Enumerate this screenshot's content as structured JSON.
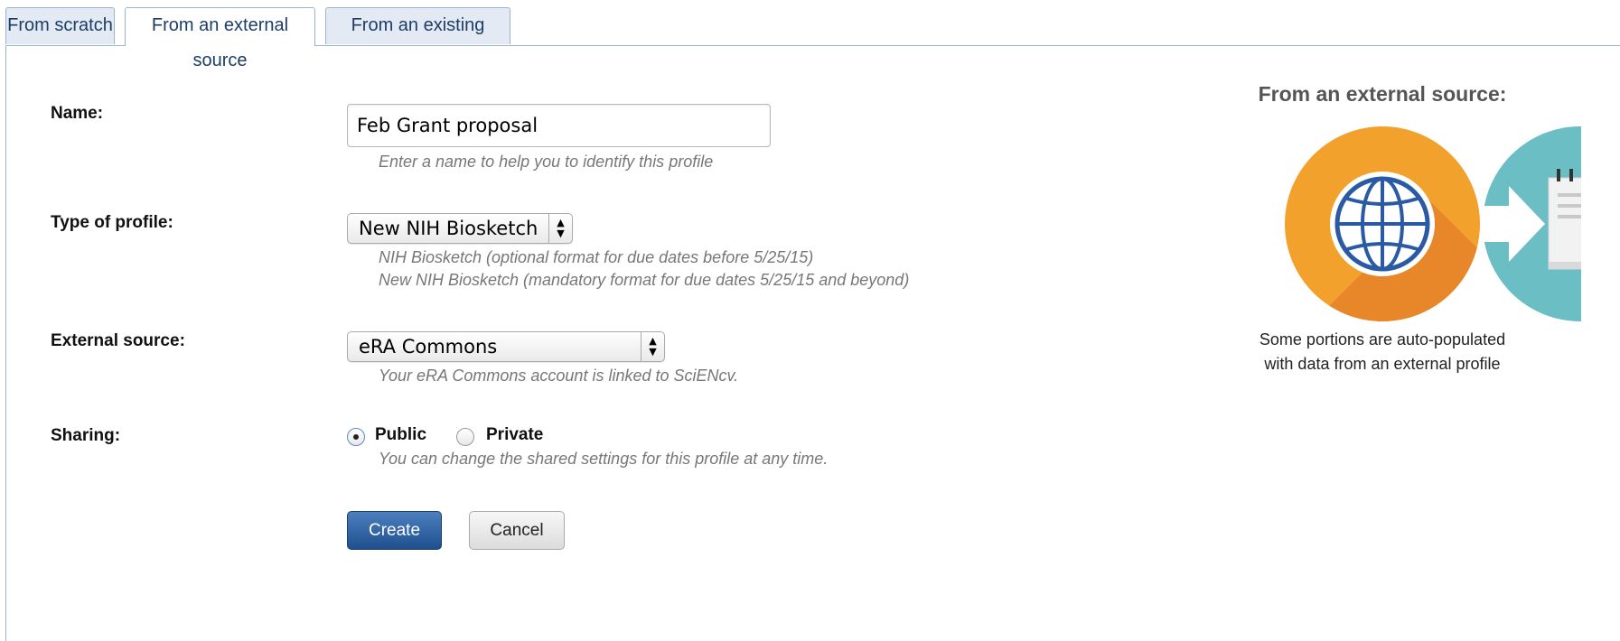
{
  "tabs": [
    {
      "label": "From scratch",
      "active": false
    },
    {
      "label": "From an external source",
      "active": true
    },
    {
      "label": "From an existing profile",
      "active": false
    }
  ],
  "form": {
    "name": {
      "label": "Name:",
      "value": "Feb Grant proposal",
      "hint": "Enter a name to help you to identify this profile"
    },
    "type": {
      "label": "Type of profile:",
      "selected": "New NIH Biosketch",
      "hint_lines": [
        "NIH Biosketch (optional format for due dates before 5/25/15)",
        "New NIH Biosketch (mandatory format for due dates 5/25/15 and beyond)"
      ]
    },
    "source": {
      "label": "External source:",
      "selected": "eRA Commons",
      "hint": "Your eRA Commons account is linked to SciENcv."
    },
    "sharing": {
      "label": "Sharing:",
      "options": [
        {
          "label": "Public",
          "checked": true
        },
        {
          "label": "Private",
          "checked": false
        }
      ],
      "hint": "You can change the shared settings for this profile at any time."
    },
    "buttons": {
      "create": "Create",
      "cancel": "Cancel"
    }
  },
  "sidebar": {
    "title": "From an external source:",
    "caption_lines": [
      "Some portions are auto-populated",
      "with data from an external profile"
    ],
    "icons": [
      "globe-icon",
      "arrow-right-icon",
      "notepad-icon"
    ]
  },
  "colors": {
    "tab_bg": "#e3eaf3",
    "tab_border": "#9db3cc",
    "tab_text": "#1c3d66",
    "primary_button": "#2a5a9a",
    "orange_circle": "#f2a22c",
    "orange_shadow": "#e8862a",
    "teal_circle": "#6bbfc4",
    "teal_shadow": "#4d9fa3",
    "globe_blue": "#2a5aa5",
    "hint_text": "#777777"
  }
}
